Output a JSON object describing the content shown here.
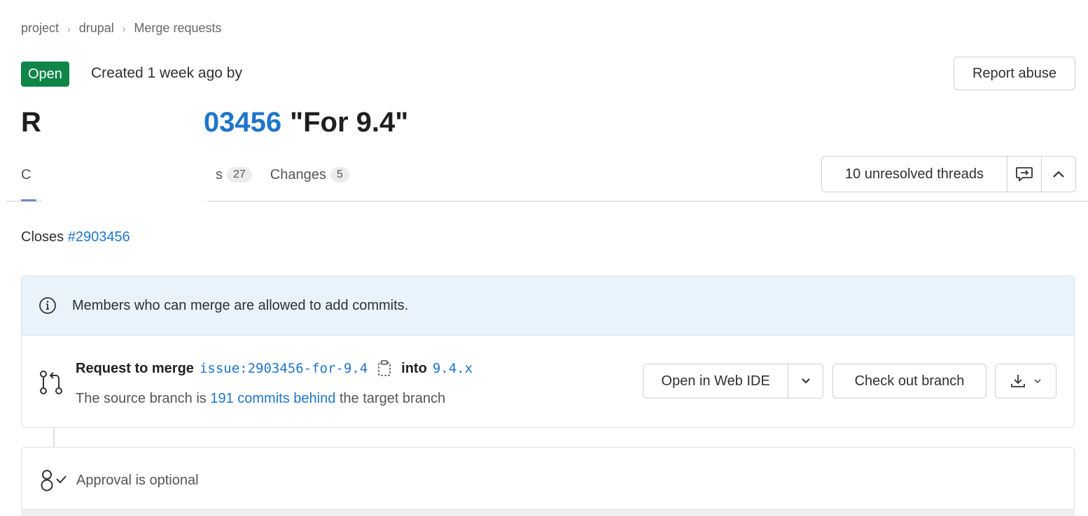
{
  "breadcrumb": {
    "items": [
      "project",
      "drupal",
      "Merge requests"
    ],
    "separator": "›"
  },
  "status": {
    "label": "Open",
    "color": "#108548"
  },
  "created_text": "Created 1 week ago by",
  "report_abuse": "Report abuse",
  "title": {
    "prefix": "R",
    "ref": "03456",
    "name": "\"For 9.4\""
  },
  "tabs": {
    "first_partial": "C",
    "commits_partial": "s",
    "commits_count": "27",
    "changes_label": "Changes",
    "changes_count": "5"
  },
  "threads": {
    "label": "10 unresolved threads"
  },
  "closes": {
    "prefix": "Closes",
    "issue": "#2903456"
  },
  "info": {
    "message": "Members who can merge are allowed to add commits."
  },
  "merge": {
    "request_label": "Request to merge",
    "source_branch": "issue:2903456-for-9.4",
    "into_label": "into",
    "target_branch": "9.4.x",
    "behind_prefix": "The source branch is",
    "behind_link": "191 commits behind",
    "behind_suffix": "the target branch",
    "open_ide_label": "Open in Web IDE",
    "checkout_label": "Check out branch"
  },
  "approval": {
    "label": "Approval is optional"
  },
  "colors": {
    "link": "#1f75cb",
    "info_bg": "#e9f3fc"
  },
  "icons": [
    "chevron-right-icon",
    "comment-icon",
    "chevron-up-icon",
    "info-icon",
    "merge-request-icon",
    "copy-icon",
    "chevron-down-icon",
    "download-icon",
    "approval-icon"
  ]
}
